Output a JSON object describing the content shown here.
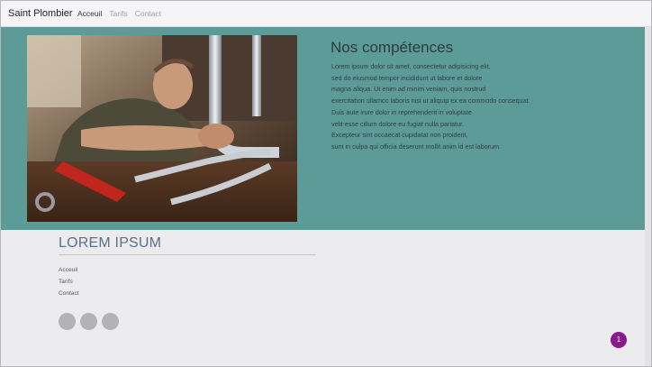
{
  "navbar": {
    "brand": "Saint Plombier",
    "links": [
      "Acceuil",
      "Tarifs",
      "Contact"
    ]
  },
  "hero": {
    "image_alt": "Plombier au travail",
    "title": "Nos compétences",
    "paragraph_lines": [
      "Lorem ipsum dolor sit amet, consectetur adipisicing elit,",
      "sed do eiusmod tempor incididunt ut labore et dolore",
      "magna aliqua. Ut enim ad minim veniam, quis nostrud",
      "exercitation ullamco laboris nisi ut aliquip ex ea commodo consequat.",
      "Duis aute irure dolor in reprehenderit in voluptate",
      "velit esse cillum dolore eu fugiat nulla pariatur.",
      "Excepteur sint occaecat cupidatat non proident,",
      "sunt in culpa qui officia deserunt mollit anim id est laborum."
    ]
  },
  "footer": {
    "heading": "LOREM IPSUM",
    "links": [
      "Acceuil",
      "Tarifs",
      "Contact"
    ],
    "social_icons": [
      "social-icon",
      "social-icon",
      "social-icon"
    ]
  },
  "badge": {
    "count": "1"
  },
  "colors": {
    "hero_bg": "#5d9b99",
    "badge": "#8a1a8a",
    "heading": "#5a7088"
  }
}
